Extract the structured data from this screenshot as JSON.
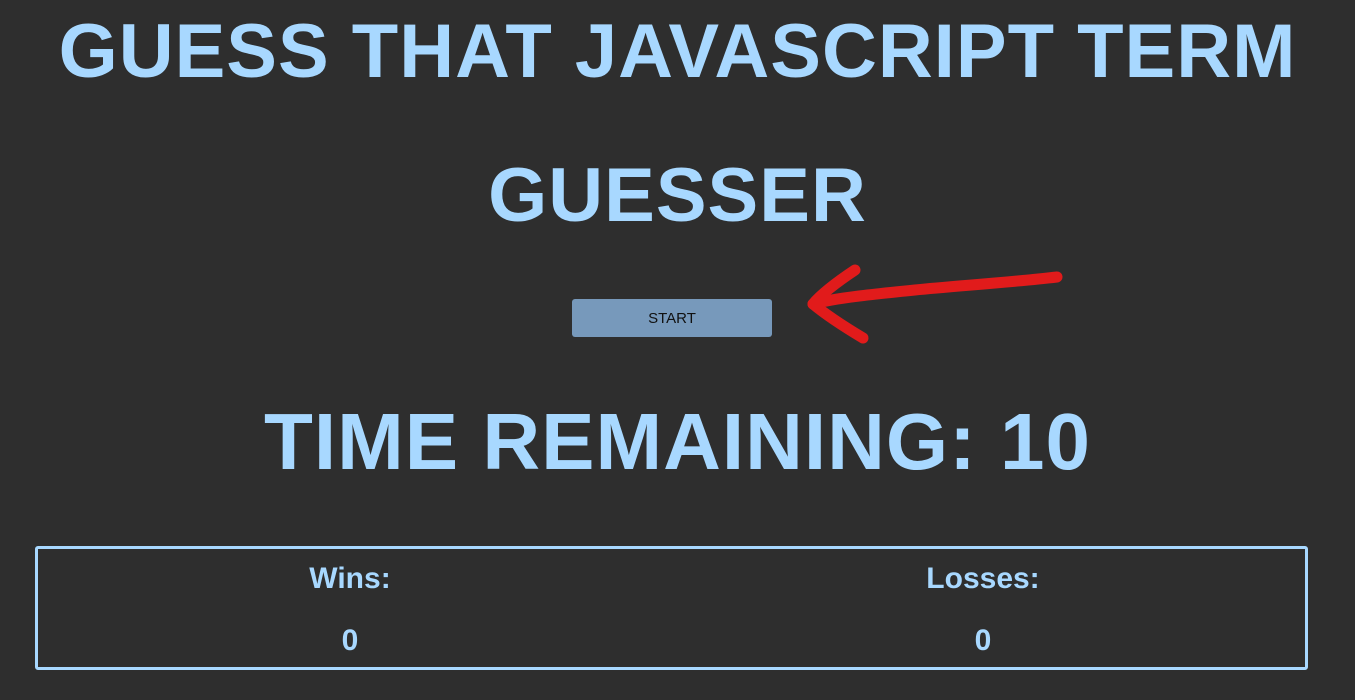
{
  "header": {
    "title_line1": "GUESS THAT JAVASCRIPT TERM",
    "title_line2": "GUESSER"
  },
  "controls": {
    "start_label": "START"
  },
  "timer": {
    "text": "TIME REMAINING: 10"
  },
  "scoreboard": {
    "wins_label": "Wins:",
    "wins_value": "0",
    "losses_label": "Losses:",
    "losses_value": "0"
  },
  "colors": {
    "background": "#2e2e2e",
    "accent": "#a8d8ff",
    "button": "#7799bb",
    "annotation_arrow": "#e11b1b"
  },
  "annotation": {
    "icon": "red-arrow-icon"
  }
}
